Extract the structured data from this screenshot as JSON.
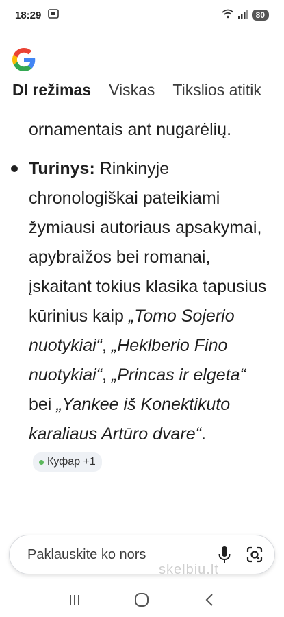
{
  "status": {
    "time": "18:29",
    "battery": "80",
    "icons": [
      "screenshot-icon",
      "wifi-icon",
      "signal-icon"
    ]
  },
  "logo": {
    "name": "google-logo-icon",
    "colors": [
      "#4285F4",
      "#EA4335",
      "#FBBC05",
      "#34A853"
    ]
  },
  "tabs": [
    {
      "label": "DI režimas",
      "active": true
    },
    {
      "label": "Viskas",
      "active": false
    },
    {
      "label": "Tikslios atitik",
      "active": false
    }
  ],
  "content": {
    "continuation": "ornamentais ant nugarėlių.",
    "bullet": {
      "label": "Turinys:",
      "text_1": " Rinkinyje chronologiškai pateikiami žymiausi autoriaus apsakymai, apybraižos bei romanai, įskaitant tokius klasika tapusius kūrinius kaip ",
      "title_1": "„Tomo Sojerio nuotykiai“",
      "sep_1": ", ",
      "title_2": "„Heklberio Fino nuotykiai“",
      "sep_2": ", ",
      "title_3": "„Princas ir elgeta“",
      "sep_3": " bei ",
      "title_4": "„Yankee iš Konektikuto karaliaus Artūro dvare“",
      "end": ".",
      "source_chip": "Куфар +1"
    }
  },
  "ask": {
    "placeholder": "Paklauskite ko nors",
    "mic_icon": "microphone-icon",
    "lens_icon": "google-lens-icon"
  },
  "watermark": "skelbiu.lt",
  "navbar": [
    "recent-apps-icon",
    "home-icon",
    "back-icon"
  ]
}
